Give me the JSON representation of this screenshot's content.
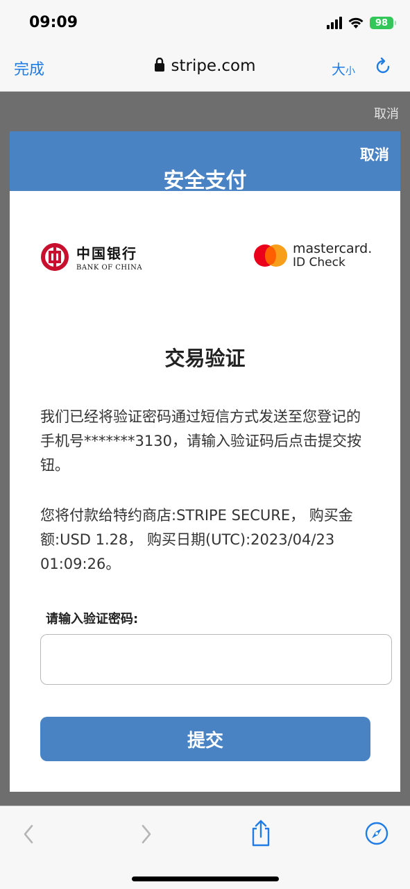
{
  "status_bar": {
    "time": "09:09",
    "battery": "98"
  },
  "browser": {
    "done_label": "完成",
    "url": "stripe.com",
    "size_label_big": "大",
    "size_label_small": "小"
  },
  "overlay": {
    "cancel_label": "取消"
  },
  "modal": {
    "cancel_label": "取消",
    "title": "安全支付",
    "bank_logo": {
      "cn": "中国银行",
      "en": "BANK OF CHINA"
    },
    "card_logo": {
      "name": "mastercard.",
      "sub": "ID Check"
    },
    "section_title": "交易验证",
    "paragraph1": "我们已经将验证密码通过短信方式发送至您登记的手机号*******3130，请输入验证码后点击提交按钮。",
    "paragraph2": "您将付款给特约商店:STRIPE SECURE， 购买金额:USD 1.28， 购买日期(UTC):2023/04/23 01:09:26。",
    "input_label": "请输入验证密码:",
    "input_value": "",
    "input_placeholder": "",
    "submit_label": "提交"
  },
  "colors": {
    "header_blue": "#4a83c4",
    "ios_blue": "#1f7ce5",
    "battery_green": "#33c759",
    "mc_red": "#eb001b",
    "mc_orange": "#f79e1b",
    "boc_red": "#c8102e"
  },
  "icons": {
    "lock": "lock-icon",
    "reload": "reload-icon",
    "back": "chevron-left-icon",
    "forward": "chevron-right-icon",
    "share": "share-icon",
    "compass": "compass-icon"
  }
}
